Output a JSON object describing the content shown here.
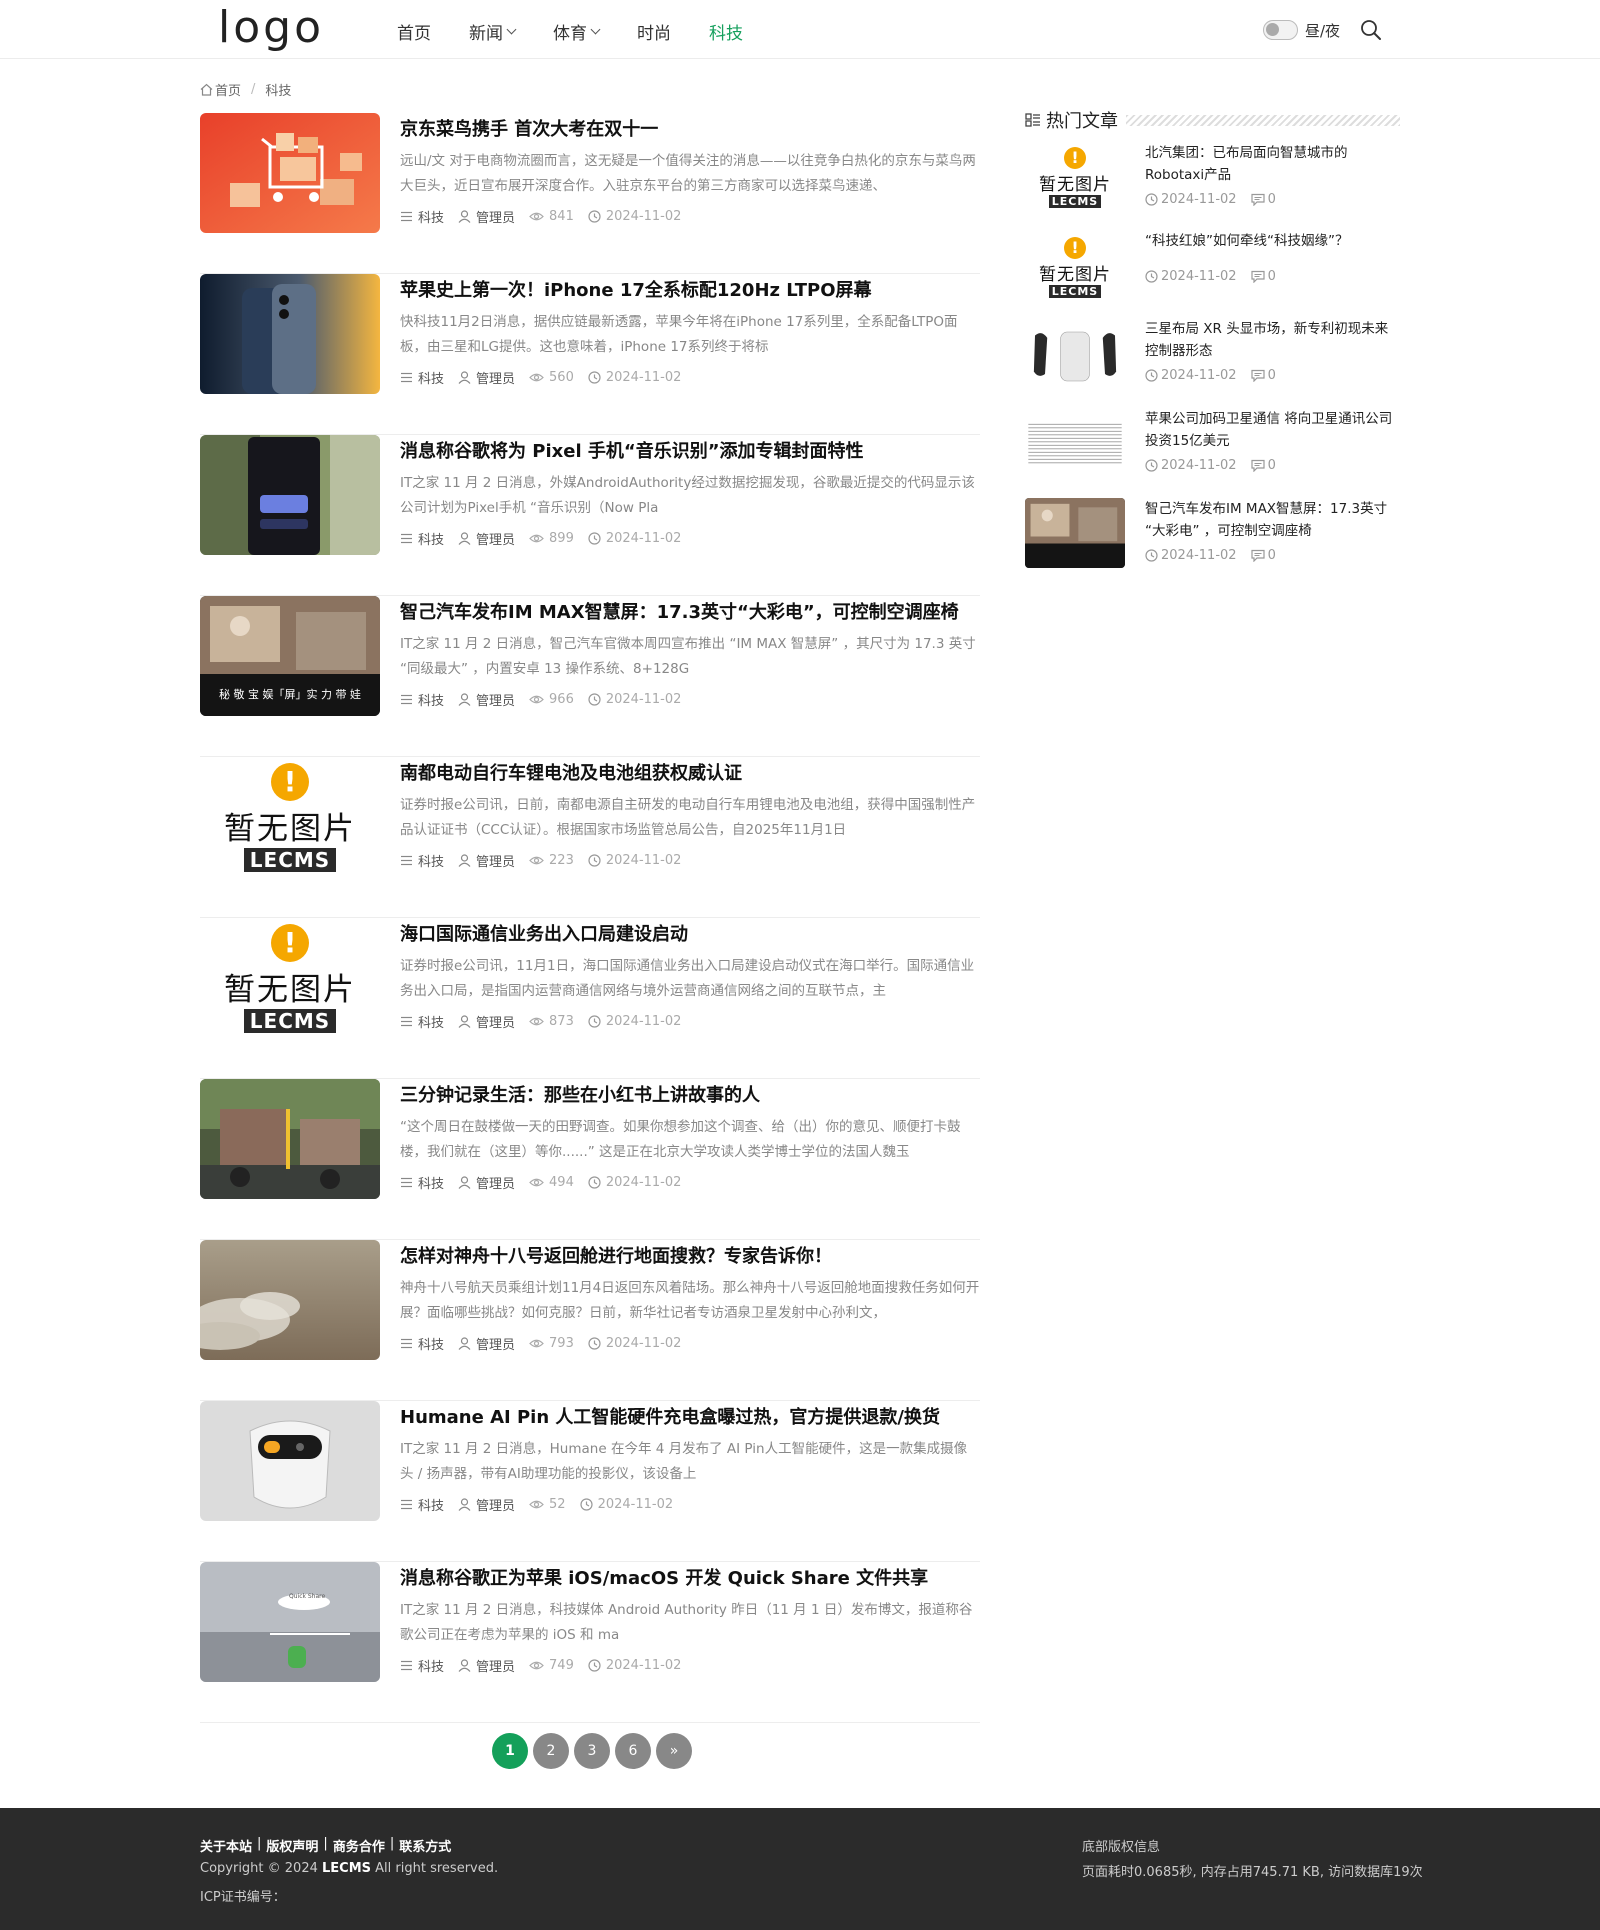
{
  "header": {
    "logo": "logo",
    "nav": [
      {
        "label": "首页",
        "dropdown": false,
        "active": false
      },
      {
        "label": "新闻",
        "dropdown": true,
        "active": false
      },
      {
        "label": "体育",
        "dropdown": true,
        "active": false
      },
      {
        "label": "时尚",
        "dropdown": false,
        "active": false
      },
      {
        "label": "科技",
        "dropdown": false,
        "active": true
      }
    ],
    "daynight_label": "昼/夜",
    "accent_color": "#16a05d"
  },
  "breadcrumb": {
    "home": "首页",
    "separator": "/",
    "current": "科技"
  },
  "articles": [
    {
      "title": "京东菜鸟携手 首次大考在双十一",
      "excerpt": "远山/文 对于电商物流圈而言，这无疑是一个值得关注的消息——以往竞争白热化的京东与菜鸟两大巨头，近日宣布展开深度合作。入驻京东平台的第三方商家可以选择菜鸟速递、",
      "category": "科技",
      "author": "管理员",
      "views": "841",
      "date": "2024-11-02",
      "thumb": "shopping-cart-image"
    },
    {
      "title": "苹果史上第一次！iPhone 17全系标配120Hz LTPO屏幕",
      "excerpt": "快科技11月2日消息，据供应链最新透露，苹果今年将在iPhone 17系列里，全系配备LTPO面板，由三星和LG提供。这也意味着，iPhone 17系列终于将标",
      "category": "科技",
      "author": "管理员",
      "views": "560",
      "date": "2024-11-02",
      "thumb": "phone-image"
    },
    {
      "title": "消息称谷歌将为 Pixel 手机“音乐识别”添加专辑封面特性",
      "excerpt": "IT之家 11 月 2 日消息，外媒AndroidAuthority经过数据挖掘发现，谷歌最近提交的代码显示该公司计划为Pixel手机 “音乐识别（Now Pla",
      "category": "科技",
      "author": "管理员",
      "views": "899",
      "date": "2024-11-02",
      "thumb": "pixel-image"
    },
    {
      "title": "智己汽车发布IM MAX智慧屏：17.3英寸“大彩电”，可控制空调座椅",
      "excerpt": "IT之家 11 月 2 日消息，智己汽车官微本周四宣布推出 “IM MAX 智慧屏” ，其尺寸为 17.3 英寸 “同级最大” ，内置安卓 13 操作系统、8+128G",
      "category": "科技",
      "author": "管理员",
      "views": "966",
      "date": "2024-11-02",
      "thumb": "car-screen-image",
      "thumb_caption": "秘 敬 宝 娱「屏」实 力 带 娃"
    },
    {
      "title": "南都电动自行车锂电池及电池组获权威认证",
      "excerpt": "证券时报e公司讯，日前，南都电源自主研发的电动自行车用锂电池及电池组，获得中国强制性产品认证证书（CCC认证）。根据国家市场监管总局公告，自2025年11月1日",
      "category": "科技",
      "author": "管理员",
      "views": "223",
      "date": "2024-11-02",
      "thumb": "noimg"
    },
    {
      "title": "海口国际通信业务出入口局建设启动",
      "excerpt": "证券时报e公司讯，11月1日，海口国际通信业务出入口局建设启动仪式在海口举行。国际通信业务出入口局，是指国内运营商通信网络与境外运营商通信网络之间的互联节点，主",
      "category": "科技",
      "author": "管理员",
      "views": "873",
      "date": "2024-11-02",
      "thumb": "noimg"
    },
    {
      "title": "三分钟记录生活：那些在小红书上讲故事的人",
      "excerpt": "“这个周日在鼓楼做一天的田野调查。如果你想参加这个调查、给（出）你的意见、顺便打卡鼓楼，我们就在（这里）等你......” 这是正在北京大学攻读人类学博士学位的法国人魏玉",
      "category": "科技",
      "author": "管理员",
      "views": "494",
      "date": "2024-11-02",
      "thumb": "street-image"
    },
    {
      "title": "怎样对神舟十八号返回舱进行地面搜救？专家告诉你！",
      "excerpt": "神舟十八号航天员乘组计划11月4日返回东风着陆场。那么神舟十八号返回舱地面搜救任务如何开展？面临哪些挑战？如何克服？日前，新华社记者专访酒泉卫星发射中心孙利文，",
      "category": "科技",
      "author": "管理员",
      "views": "793",
      "date": "2024-11-02",
      "thumb": "desert-image"
    },
    {
      "title": "Humane AI Pin 人工智能硬件充电盒曝过热，官方提供退款/换货",
      "excerpt": "IT之家 11 月 2 日消息，Humane 在今年 4 月发布了 AI Pin人工智能硬件，这是一款集成摄像头 / 扬声器，带有AI助理功能的投影仪，该设备上",
      "category": "科技",
      "author": "管理员",
      "views": "52",
      "date": "2024-11-02",
      "thumb": "ai-pin-image"
    },
    {
      "title": "消息称谷歌正为苹果 iOS/macOS 开发 Quick Share 文件共享",
      "excerpt": "IT之家 11 月 2 日消息，科技媒体 Android Authority 昨日（11 月 1 日）发布博文，报道称谷歌公司正在考虑为苹果的 iOS 和 ma",
      "category": "科技",
      "author": "管理员",
      "views": "749",
      "date": "2024-11-02",
      "thumb": "quickshare-image",
      "thumb_caption": "Quick Share"
    }
  ],
  "pagination": {
    "pages": [
      "1",
      "2",
      "3",
      "6",
      "»"
    ],
    "current": "1"
  },
  "sidebar": {
    "title": "热门文章",
    "items": [
      {
        "title": "北汽集团：已布局面向智慧城市的Robotaxi产品",
        "date": "2024-11-02",
        "comments": "0",
        "thumb": "noimg"
      },
      {
        "title": "“科技红娘”如何牵线“科技姻缘”？",
        "date": "2024-11-02",
        "comments": "0",
        "thumb": "noimg"
      },
      {
        "title": "三星布局 XR 头显市场，新专利初现未来控制器形态",
        "date": "2024-11-02",
        "comments": "0",
        "thumb": "controller-image"
      },
      {
        "title": "苹果公司加码卫星通信 将向卫星通讯公司投资15亿美元",
        "date": "2024-11-02",
        "comments": "0",
        "thumb": "document-image"
      },
      {
        "title": "智己汽车发布IM MAX智慧屏：17.3英寸 “大彩电” ，可控制空调座椅",
        "date": "2024-11-02",
        "comments": "0",
        "thumb": "car-screen-image"
      }
    ]
  },
  "placeholder": {
    "text": "暂无图片",
    "brand": "LECMS",
    "mark": "!"
  },
  "footer": {
    "links": [
      "关于本站",
      "版权声明",
      "商务合作",
      "联系方式"
    ],
    "link_separator": "|",
    "copyright_prefix": "Copyright © 2024 ",
    "copyright_brand": "LECMS",
    "copyright_suffix": " All right sreserved.",
    "icp": "ICP证书编号：",
    "right_title": "底部版权信息",
    "right_stats": "页面耗时0.0685秒, 内存占用745.71 KB, 访问数据库19次"
  }
}
